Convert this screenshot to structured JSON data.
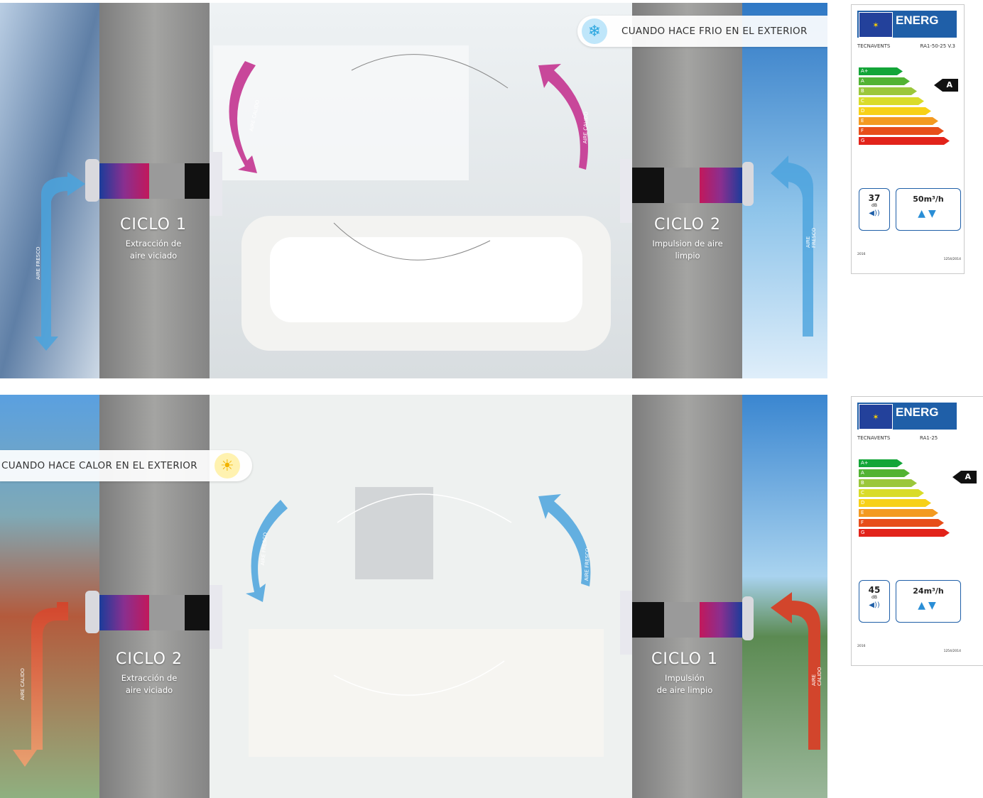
{
  "panels": [
    {
      "id": "cold",
      "caption": "CUANDO HACE FRIO EN EL EXTERIOR",
      "caption_icon": "snowflake-icon",
      "left_unit": {
        "title": "CICLO 1",
        "desc": [
          "Extracción de",
          "aire viciado"
        ]
      },
      "right_unit": {
        "title": "CICLO 2",
        "desc": [
          "Impulsion de aire",
          "limpio"
        ]
      },
      "arrow_inner_left": "AIRE CALIDO",
      "arrow_inner_right": "AIRE CALIDO",
      "arrow_outer_left": "AIRE FRESCO",
      "arrow_outer_right": "AIRE FRESCO",
      "colors": {
        "inner_arrow": "#c8479a",
        "outer_arrow": "#4aa3dd"
      }
    },
    {
      "id": "hot",
      "caption": "CUANDO HACE CALOR EN EL EXTERIOR",
      "caption_icon": "sun-icon",
      "left_unit": {
        "title": "CICLO 2",
        "desc": [
          "Extracción de",
          "aire viciado"
        ]
      },
      "right_unit": {
        "title": "CICLO 1",
        "desc": [
          "Impulsión",
          "de aire limpio"
        ]
      },
      "arrow_inner_left": "AIRE FRESCO",
      "arrow_inner_right": "AIRE FRESCO",
      "arrow_outer_left": "AIRE CALIDO",
      "arrow_outer_right": "AIRE CALIDO",
      "colors": {
        "inner_arrow": "#4aa3dd",
        "outer_arrow": "#d2452c"
      }
    }
  ],
  "labels": [
    {
      "header": "ENERG",
      "brand": "TECNAVENTS",
      "model": "RA1-50-25 V.3",
      "classes": [
        "A+",
        "A",
        "B",
        "C",
        "D",
        "E",
        "F",
        "G"
      ],
      "rating": "A",
      "noise_value": "37",
      "noise_unit": "dB",
      "flow": "50m³/h",
      "footer_left": "2016",
      "footer_right": "1254/2014"
    },
    {
      "header": "ENERG",
      "brand": "TECNAVENTS",
      "model": "RA1-25",
      "classes": [
        "A+",
        "A",
        "B",
        "C",
        "D",
        "E",
        "F",
        "G"
      ],
      "rating": "A",
      "noise_value": "45",
      "noise_unit": "dB",
      "flow": "24m³/h",
      "footer_left": "2016",
      "footer_right": "1254/2014"
    }
  ],
  "class_colors": [
    "#13a538",
    "#52b333",
    "#9bc73b",
    "#d9dc2a",
    "#f7d117",
    "#f39a21",
    "#e74e1a",
    "#e2231a"
  ]
}
